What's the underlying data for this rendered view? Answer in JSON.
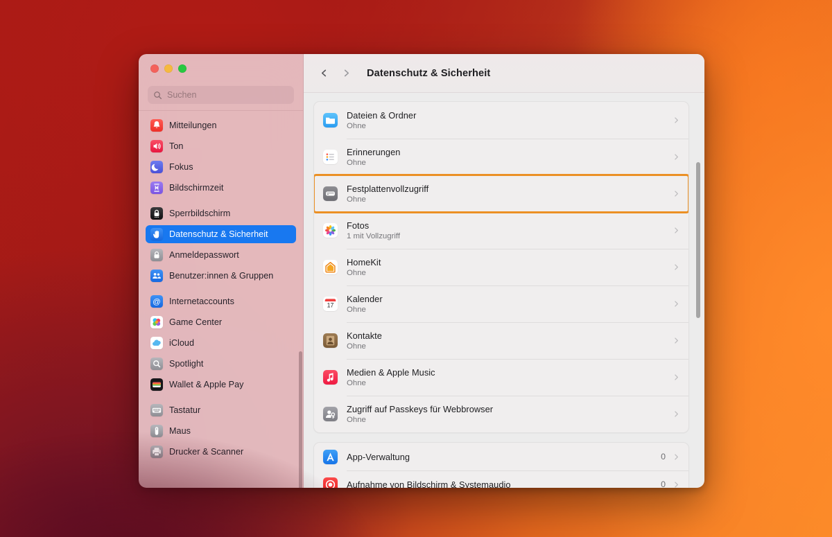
{
  "window": {
    "traffic_lights": [
      {
        "name": "close",
        "color": "#f4615b"
      },
      {
        "name": "minimize",
        "color": "#f6b93f"
      },
      {
        "name": "zoom",
        "color": "#28c840"
      }
    ]
  },
  "search": {
    "value": "",
    "placeholder": "Suchen",
    "icon": "search-icon"
  },
  "sidebar": {
    "groups": [
      {
        "items": [
          {
            "label": "Mitteilungen",
            "icon": "notifications-icon",
            "selected": false
          },
          {
            "label": "Ton",
            "icon": "sound-icon",
            "selected": false
          },
          {
            "label": "Fokus",
            "icon": "focus-icon",
            "selected": false
          },
          {
            "label": "Bildschirmzeit",
            "icon": "screen-time-icon",
            "selected": false
          }
        ]
      },
      {
        "items": [
          {
            "label": "Sperrbildschirm",
            "icon": "lock-screen-icon",
            "selected": false
          },
          {
            "label": "Datenschutz & Sicherheit",
            "icon": "privacy-icon",
            "selected": true
          },
          {
            "label": "Anmeldepasswort",
            "icon": "login-password-icon",
            "selected": false
          },
          {
            "label": "Benutzer:innen & Gruppen",
            "icon": "users-groups-icon",
            "selected": false
          }
        ]
      },
      {
        "items": [
          {
            "label": "Internetaccounts",
            "icon": "internet-accounts-icon",
            "selected": false
          },
          {
            "label": "Game Center",
            "icon": "game-center-icon",
            "selected": false
          },
          {
            "label": "iCloud",
            "icon": "icloud-icon",
            "selected": false
          },
          {
            "label": "Spotlight",
            "icon": "spotlight-icon",
            "selected": false
          },
          {
            "label": "Wallet & Apple Pay",
            "icon": "wallet-icon",
            "selected": false
          }
        ]
      },
      {
        "items": [
          {
            "label": "Tastatur",
            "icon": "keyboard-icon",
            "selected": false
          },
          {
            "label": "Maus",
            "icon": "mouse-icon",
            "selected": false
          },
          {
            "label": "Drucker & Scanner",
            "icon": "printer-icon",
            "selected": false
          }
        ]
      }
    ]
  },
  "toolbar": {
    "back_icon": "chevron-left-icon",
    "forward_icon": "chevron-right-icon",
    "title": "Datenschutz & Sicherheit"
  },
  "content": {
    "cards": [
      {
        "rows": [
          {
            "title": "Dateien & Ordner",
            "subtitle": "Ohne",
            "icon": "files-folders-icon",
            "count": "",
            "highlighted": false
          },
          {
            "title": "Erinnerungen",
            "subtitle": "Ohne",
            "icon": "reminders-icon",
            "count": "",
            "highlighted": false
          },
          {
            "title": "Festplattenvollzugriff",
            "subtitle": "Ohne",
            "icon": "full-disk-access-icon",
            "count": "",
            "highlighted": true
          },
          {
            "title": "Fotos",
            "subtitle": "1 mit Vollzugriff",
            "icon": "photos-icon",
            "count": "",
            "highlighted": false
          },
          {
            "title": "HomeKit",
            "subtitle": "Ohne",
            "icon": "homekit-icon",
            "count": "",
            "highlighted": false
          },
          {
            "title": "Kalender",
            "subtitle": "Ohne",
            "icon": "calendar-icon",
            "count": "",
            "highlighted": false
          },
          {
            "title": "Kontakte",
            "subtitle": "Ohne",
            "icon": "contacts-icon",
            "count": "",
            "highlighted": false
          },
          {
            "title": "Medien & Apple Music",
            "subtitle": "Ohne",
            "icon": "music-icon",
            "count": "",
            "highlighted": false
          },
          {
            "title": "Zugriff auf Passkeys für Webbrowser",
            "subtitle": "Ohne",
            "icon": "passkeys-icon",
            "count": "",
            "highlighted": false
          }
        ]
      },
      {
        "rows": [
          {
            "title": "App-Verwaltung",
            "subtitle": "",
            "icon": "app-management-icon",
            "count": "0",
            "highlighted": false
          },
          {
            "title": "Aufnahme von Bildschirm & Systemaudio",
            "subtitle": "",
            "icon": "screen-recording-icon",
            "count": "0",
            "highlighted": false
          }
        ]
      }
    ]
  },
  "colors": {
    "highlight_ring": "#eb9024",
    "sidebar_selection": "#1878f0",
    "wallpaper_red": "#a81b16",
    "wallpaper_orange": "#f58026"
  },
  "calendar_icon_day": "17"
}
